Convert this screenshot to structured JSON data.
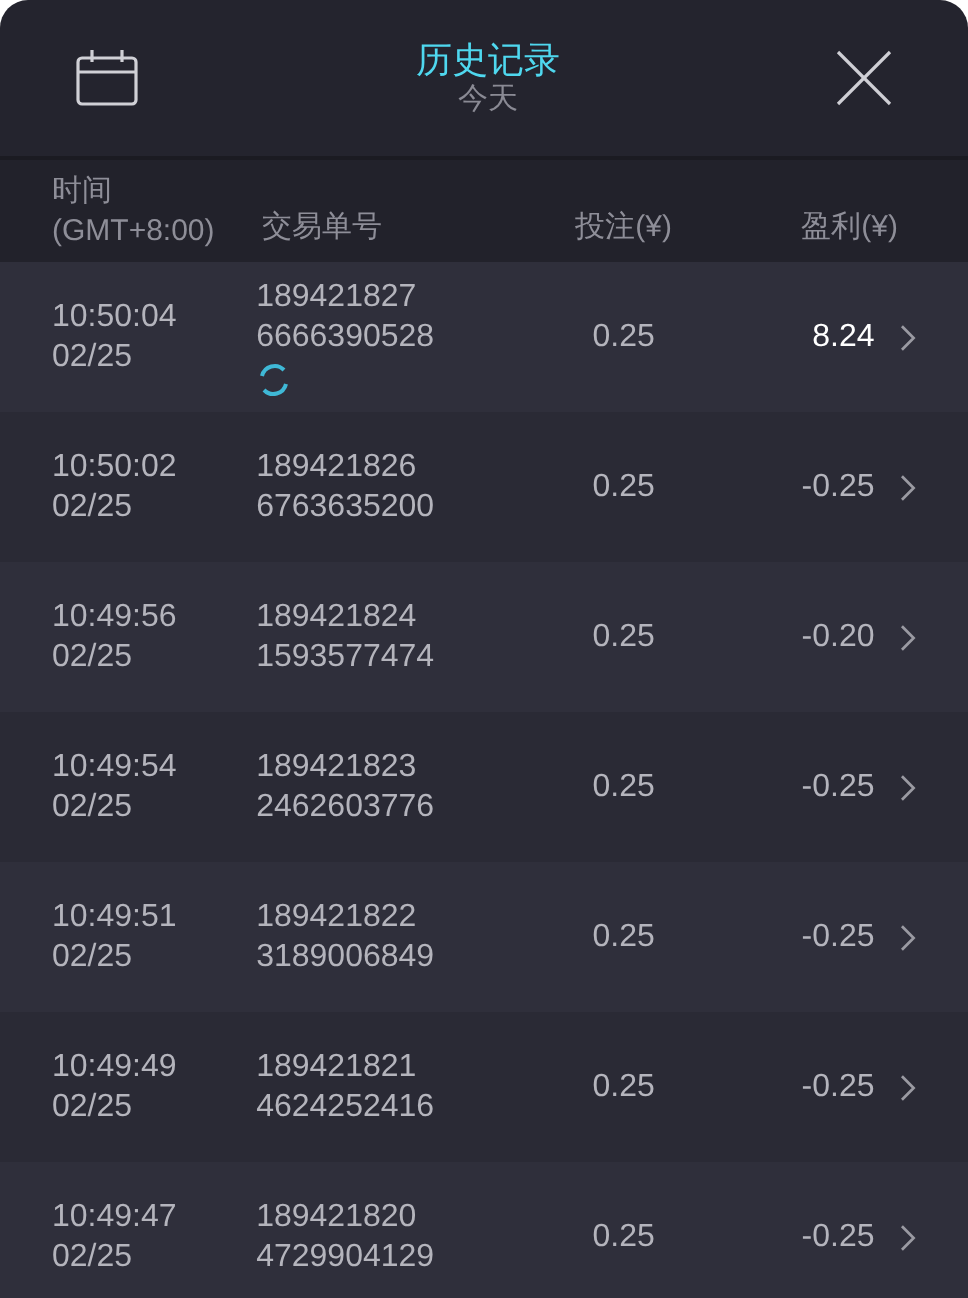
{
  "header": {
    "title": "历史记录",
    "subtitle": "今天"
  },
  "columns": [
    "时间\n(GMT+8:00)",
    "交易单号",
    "投注(¥)",
    "盈利(¥)"
  ],
  "rows": [
    {
      "time": "10:50:04",
      "date": "02/25",
      "id1": "189421827",
      "id2": "6666390528",
      "bet": "0.25",
      "profit": "8.24",
      "win": true,
      "pending": true
    },
    {
      "time": "10:50:02",
      "date": "02/25",
      "id1": "189421826",
      "id2": "6763635200",
      "bet": "0.25",
      "profit": "-0.25",
      "win": false,
      "pending": false
    },
    {
      "time": "10:49:56",
      "date": "02/25",
      "id1": "189421824",
      "id2": "1593577474",
      "bet": "0.25",
      "profit": "-0.20",
      "win": false,
      "pending": false
    },
    {
      "time": "10:49:54",
      "date": "02/25",
      "id1": "189421823",
      "id2": "2462603776",
      "bet": "0.25",
      "profit": "-0.25",
      "win": false,
      "pending": false
    },
    {
      "time": "10:49:51",
      "date": "02/25",
      "id1": "189421822",
      "id2": "3189006849",
      "bet": "0.25",
      "profit": "-0.25",
      "win": false,
      "pending": false
    },
    {
      "time": "10:49:49",
      "date": "02/25",
      "id1": "189421821",
      "id2": "4624252416",
      "bet": "0.25",
      "profit": "-0.25",
      "win": false,
      "pending": false
    },
    {
      "time": "10:49:47",
      "date": "02/25",
      "id1": "189421820",
      "id2": "4729904129",
      "bet": "0.25",
      "profit": "-0.25",
      "win": false,
      "pending": false
    }
  ]
}
